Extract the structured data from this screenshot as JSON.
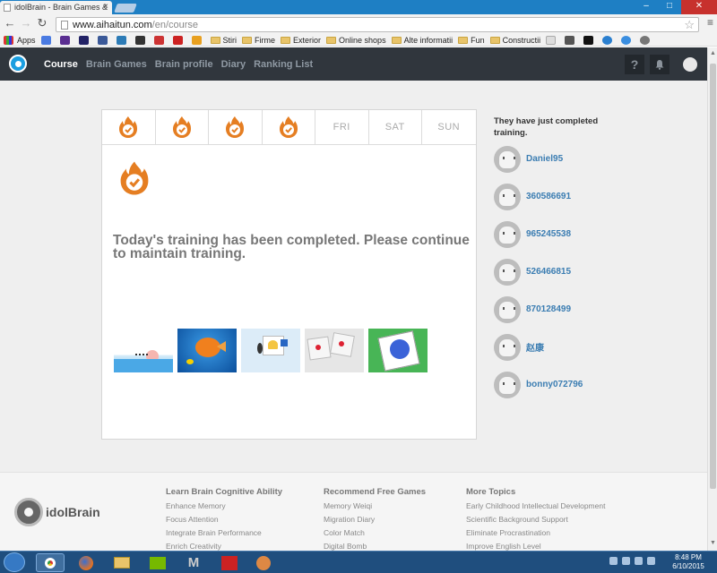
{
  "browser": {
    "tab_title": "idolBrain - Brain Games &",
    "url_domain": "www.aihaitun.com",
    "url_path": "/en/course",
    "bookmarks": [
      "Apps",
      "Stiri",
      "Firme",
      "Exterior",
      "Online shops",
      "Alte informatii",
      "Fun",
      "Constructii"
    ]
  },
  "nav": {
    "items": [
      "Course",
      "Brain Games",
      "Brain profile",
      "Diary",
      "Ranking List"
    ],
    "help_label": "?"
  },
  "week": {
    "days": [
      "",
      "",
      "",
      "",
      "FRI",
      "SAT",
      "SUN"
    ],
    "completed": [
      true,
      true,
      true,
      true,
      false,
      false,
      false
    ]
  },
  "training": {
    "message": "Today's training has been completed. Please continue to maintain training."
  },
  "sidebar": {
    "title": "They have just completed training.",
    "users": [
      "Daniel95",
      "360586691",
      "965245538",
      "526466815",
      "870128499",
      "赵康",
      "bonny072796"
    ]
  },
  "footer": {
    "brand": "idolBrain",
    "col1": {
      "title": "Learn Brain Cognitive Ability",
      "links": [
        "Enhance Memory",
        "Focus Attention",
        "Integrate Brain Performance",
        "Enrich Creativity"
      ]
    },
    "col2": {
      "title": "Recommend Free Games",
      "links": [
        "Memory Weiqi",
        "Migration Diary",
        "Color Match",
        "Digital Bomb"
      ]
    },
    "col3": {
      "title": "More Topics",
      "links": [
        "Early Childhood Intellectual Development",
        "Scientific Background Support",
        "Eliminate Procrastination",
        "Improve English Level"
      ]
    }
  },
  "taskbar": {
    "time": "8:48 PM",
    "date": "6/10/2015"
  },
  "colors": {
    "flame": "#e57e22",
    "nav_bg": "#30363d",
    "link": "#3b7db2"
  }
}
